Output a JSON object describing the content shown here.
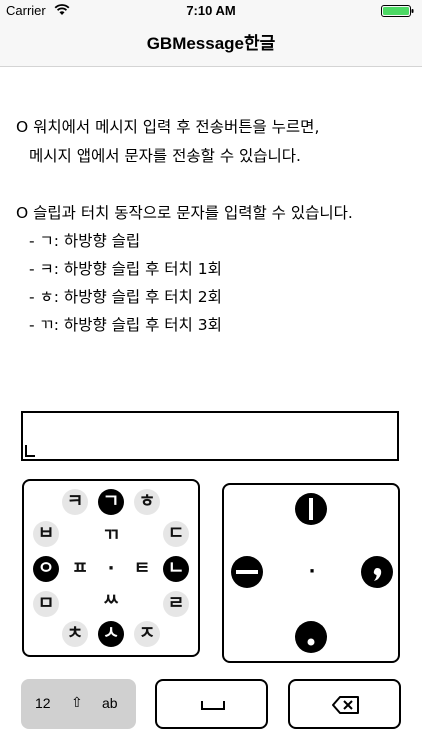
{
  "status_bar": {
    "carrier": "Carrier",
    "time": "7:10 AM"
  },
  "nav": {
    "title": "GBMessage한글"
  },
  "instructions": {
    "line1": "O 워치에서 메시지 입력 후 전송버튼을 누르면,",
    "line2": "메시지 앱에서 문자를 전송할 수 있습니다.",
    "line3": "O 슬립과 터치 동작으로 문자를 입력할 수 있습니다.",
    "items": [
      "- ㄱ: 하방향 슬립",
      "- ㅋ: 하방향 슬립 후 터치 1회",
      "- ㅎ: 하방향 슬립 후 터치 2회",
      "- ㄲ: 하방향 슬립 후 터치 3회"
    ]
  },
  "message_input": {
    "value": ""
  },
  "consonant_pad": {
    "keys": [
      "ㅋ",
      "ㄱ",
      "ㅎ",
      "ㅂ",
      "ㄲ",
      "ㄷ",
      "ㅇ",
      "ㅍ",
      "·",
      "ㅌ",
      "ㄴ",
      "ㅁ",
      "ㅆ",
      "ㄹ",
      "ㅊ",
      "ㅅ",
      "ㅈ"
    ]
  },
  "vowel_pad": {
    "center": "·"
  },
  "mode_switch": {
    "numbers": "12",
    "shift": "⇧",
    "alpha": "ab"
  },
  "colors": {
    "bar_bg": "#f7f7f7",
    "key_bg": "#e6e6e6",
    "mode_bg": "#d0d0d0",
    "battery": "#4cd964"
  }
}
